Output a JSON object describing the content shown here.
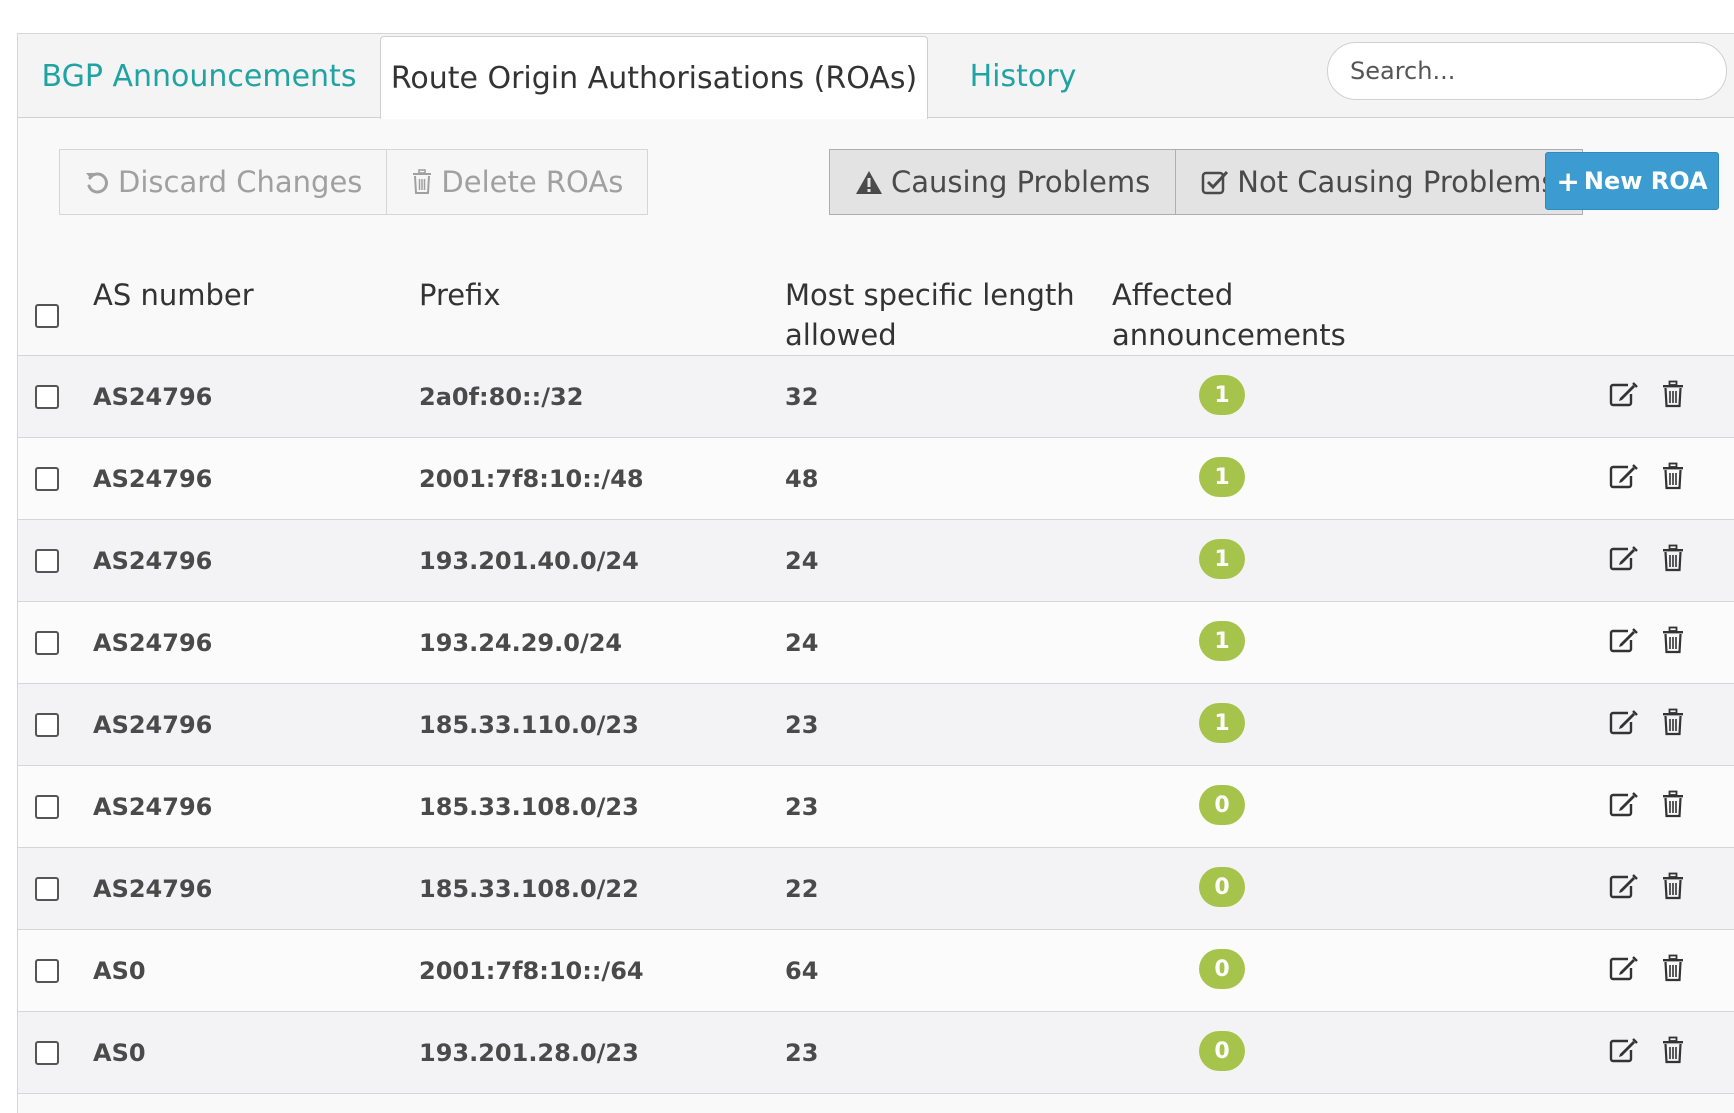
{
  "tabs": {
    "bgp": "BGP Announcements",
    "roas": "Route Origin Authorisations (ROAs)",
    "history": "History"
  },
  "search": {
    "placeholder": "Search..."
  },
  "toolbar": {
    "discard_label": "Discard Changes",
    "delete_label": "Delete ROAs",
    "causing_label": "Causing Problems",
    "not_causing_label": "Not Causing Problems",
    "new_roa_label": "New ROA"
  },
  "table": {
    "headers": {
      "as_number": "AS number",
      "prefix": "Prefix",
      "max_length_line1": "Most specific length",
      "max_length_line2": "allowed",
      "affected_line1": "Affected",
      "affected_line2": "announcements"
    },
    "rows": [
      {
        "as": "AS24796",
        "prefix": "2a0f:80::/32",
        "max": "32",
        "affected": "1"
      },
      {
        "as": "AS24796",
        "prefix": "2001:7f8:10::/48",
        "max": "48",
        "affected": "1"
      },
      {
        "as": "AS24796",
        "prefix": "193.201.40.0/24",
        "max": "24",
        "affected": "1"
      },
      {
        "as": "AS24796",
        "prefix": "193.24.29.0/24",
        "max": "24",
        "affected": "1"
      },
      {
        "as": "AS24796",
        "prefix": "185.33.110.0/23",
        "max": "23",
        "affected": "1"
      },
      {
        "as": "AS24796",
        "prefix": "185.33.108.0/23",
        "max": "23",
        "affected": "0"
      },
      {
        "as": "AS24796",
        "prefix": "185.33.108.0/22",
        "max": "22",
        "affected": "0"
      },
      {
        "as": "AS0",
        "prefix": "2001:7f8:10::/64",
        "max": "64",
        "affected": "0"
      },
      {
        "as": "AS0",
        "prefix": "193.201.28.0/23",
        "max": "23",
        "affected": "0"
      }
    ]
  },
  "colors": {
    "tab_link": "#21a3a3",
    "primary_button": "#3c9cd1",
    "badge": "#a6c44c"
  }
}
